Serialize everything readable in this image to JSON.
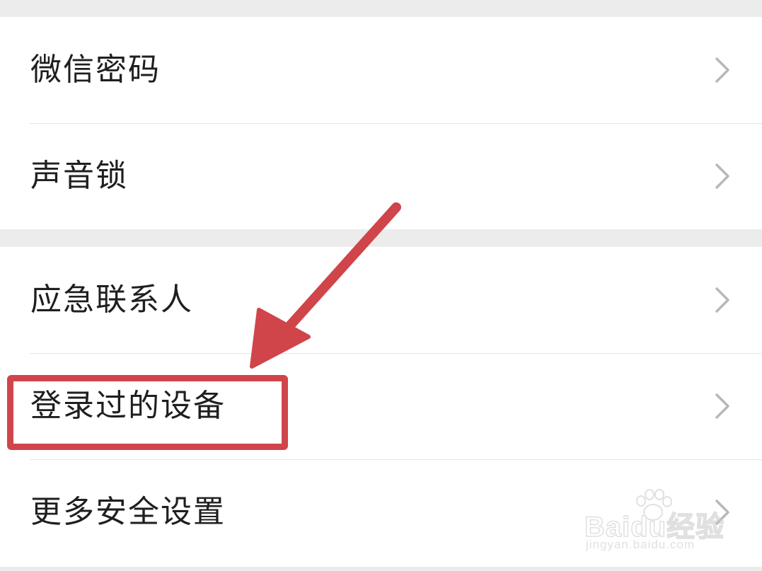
{
  "settings": {
    "group1": [
      {
        "label": "微信密码"
      },
      {
        "label": "声音锁"
      }
    ],
    "group2": [
      {
        "label": "应急联系人"
      },
      {
        "label": "登录过的设备"
      },
      {
        "label": "更多安全设置"
      }
    ]
  },
  "annotation": {
    "color": "#d0454a",
    "highlighted_item": "登录过的设备"
  },
  "watermark": {
    "logo_text": "Baidu经验",
    "url": "jingyan.baidu.com"
  },
  "icons": {
    "row_chevron": "chevron-right-icon"
  },
  "colors": {
    "background": "#ececec",
    "row_background": "#ffffff",
    "text": "#1f1f1f",
    "chevron": "#b8b8b8"
  }
}
